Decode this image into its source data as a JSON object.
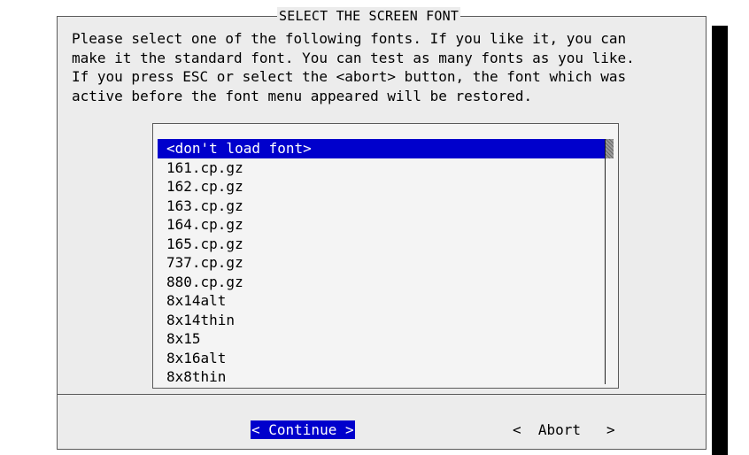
{
  "dialog": {
    "title": "SELECT THE SCREEN FONT",
    "prompt": "Please select one of the following fonts. If you like it, you can\nmake it the standard font. You can test as many fonts as you like.\nIf you press ESC or select the <abort> button, the font which was\nactive before the font menu appeared will be restored."
  },
  "font_list": {
    "selected_index": 0,
    "items": [
      "<don't load font>",
      "161.cp.gz",
      "162.cp.gz",
      "163.cp.gz",
      "164.cp.gz",
      "165.cp.gz",
      "737.cp.gz",
      "880.cp.gz",
      "8x14alt",
      "8x14thin",
      "8x15",
      "8x16alt",
      "8x8thin"
    ]
  },
  "buttons": {
    "continue_label": "< Continue >",
    "abort_label": "<  Abort   >"
  },
  "colors": {
    "highlight": "#0000cc",
    "dialog_bg": "#ececec",
    "border": "#5a5a5a"
  }
}
